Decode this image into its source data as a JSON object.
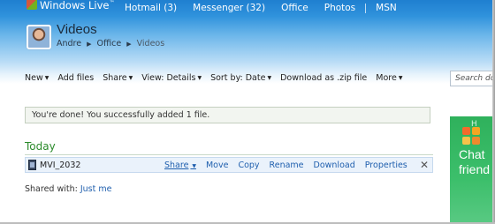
{
  "header": {
    "brand": "Windows Live",
    "brand_tm": "™",
    "nav": [
      "Hotmail (3)",
      "Messenger (32)",
      "Office",
      "Photos"
    ],
    "nav_extra": "MSN"
  },
  "page": {
    "title": "Videos",
    "breadcrumb": [
      "Andre",
      "Office",
      "Videos"
    ]
  },
  "toolbar": {
    "commands": [
      {
        "label": "New",
        "dropdown": true
      },
      {
        "label": "Add files",
        "dropdown": false
      },
      {
        "label": "Share",
        "dropdown": true
      },
      {
        "label": "View: Details",
        "dropdown": true
      },
      {
        "label": "Sort by: Date",
        "dropdown": true
      },
      {
        "label": "Download as .zip file",
        "dropdown": false
      },
      {
        "label": "More",
        "dropdown": true
      }
    ],
    "search_placeholder": "Search documents"
  },
  "notice": "You're done! You successfully added 1 file.",
  "group": {
    "heading": "Today",
    "file": {
      "name": "MVI_2032",
      "actions": [
        "Share",
        "Move",
        "Copy",
        "Rename",
        "Download",
        "Properties"
      ],
      "close": "✕"
    }
  },
  "shared": {
    "label": "Shared with:",
    "value": "Just me"
  },
  "ad": {
    "brand": "H",
    "headline_1": "Chat",
    "headline_2": "friend"
  },
  "colors": {
    "accent_link": "#1f5fae",
    "group_heading": "#2a8a2a",
    "ad_green": "#3cbf6b"
  }
}
